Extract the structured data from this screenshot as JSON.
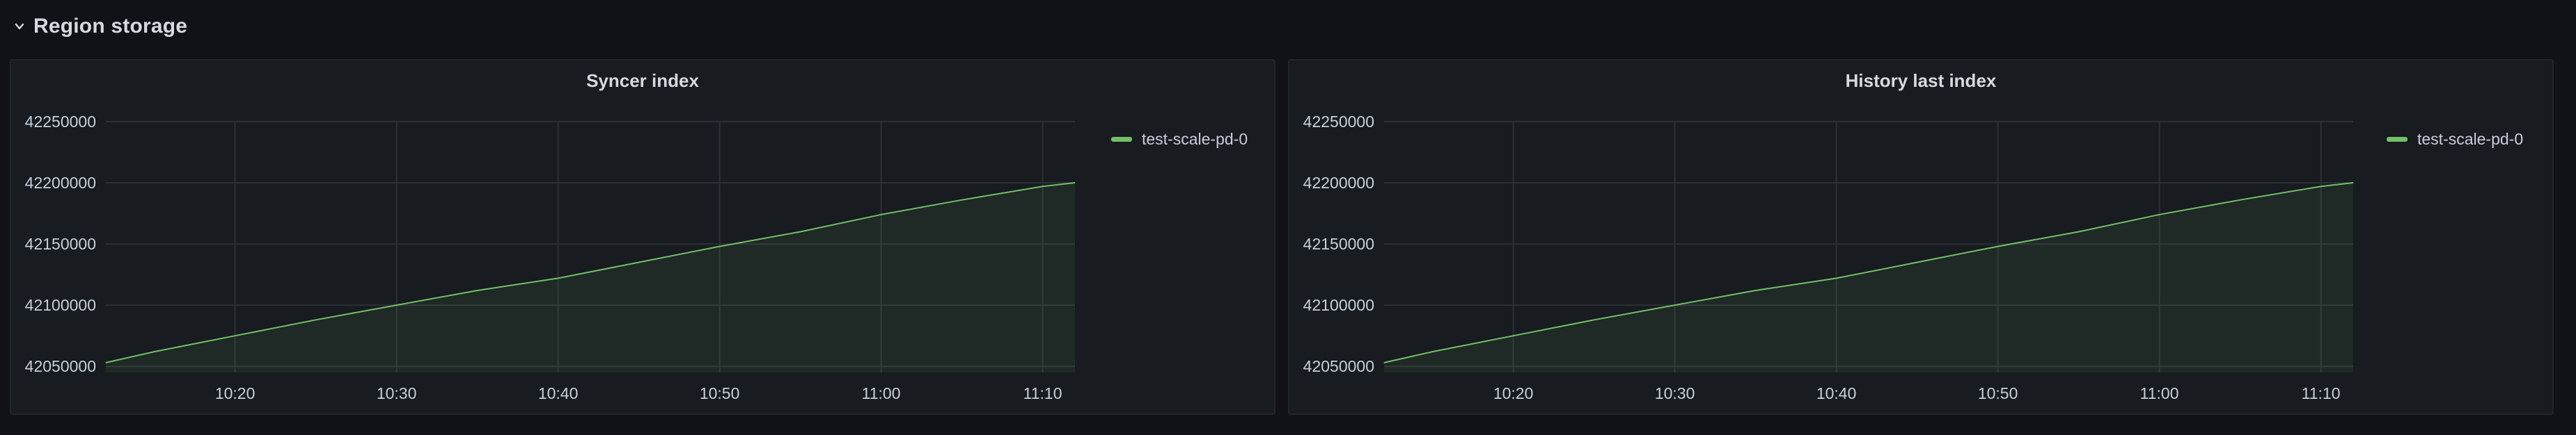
{
  "row": {
    "title": "Region storage",
    "icon": "chevron-down-icon"
  },
  "colors": {
    "series": "#73bf69",
    "grid": "#2c3036",
    "panel_bg": "#181b1f",
    "page_bg": "#111217"
  },
  "panels": [
    {
      "title": "Syncer index",
      "legend": "test-scale-pd-0"
    },
    {
      "title": "History last index",
      "legend": "test-scale-pd-0"
    }
  ],
  "chart_data": [
    {
      "type": "area",
      "title": "Syncer index",
      "x_tick_labels": [
        "10:20",
        "10:30",
        "10:40",
        "10:50",
        "11:00",
        "11:10"
      ],
      "y_tick_labels": [
        "42250000",
        "42200000",
        "42150000",
        "42100000",
        "42050000"
      ],
      "xlim": [
        "10:12",
        "11:12"
      ],
      "ylim": [
        42045000,
        42250000
      ],
      "grid": true,
      "legend_position": "right",
      "series": [
        {
          "name": "test-scale-pd-0",
          "x": [
            "10:12",
            "10:15",
            "10:20",
            "10:25",
            "10:30",
            "10:35",
            "10:40",
            "10:45",
            "10:50",
            "10:55",
            "11:00",
            "11:05",
            "11:10",
            "11:12"
          ],
          "values": [
            42053000,
            42062000,
            42075000,
            42088000,
            42100000,
            42112000,
            42122000,
            42135000,
            42148000,
            42160000,
            42174000,
            42186000,
            42197000,
            42200000
          ]
        }
      ]
    },
    {
      "type": "area",
      "title": "History last index",
      "x_tick_labels": [
        "10:20",
        "10:30",
        "10:40",
        "10:50",
        "11:00",
        "11:10"
      ],
      "y_tick_labels": [
        "42250000",
        "42200000",
        "42150000",
        "42100000",
        "42050000"
      ],
      "xlim": [
        "10:12",
        "11:12"
      ],
      "ylim": [
        42045000,
        42250000
      ],
      "grid": true,
      "legend_position": "right",
      "series": [
        {
          "name": "test-scale-pd-0",
          "x": [
            "10:12",
            "10:15",
            "10:20",
            "10:25",
            "10:30",
            "10:35",
            "10:40",
            "10:45",
            "10:50",
            "10:55",
            "11:00",
            "11:05",
            "11:10",
            "11:12"
          ],
          "values": [
            42053000,
            42062000,
            42075000,
            42088000,
            42100000,
            42112000,
            42122000,
            42135000,
            42148000,
            42160000,
            42174000,
            42186000,
            42197000,
            42200000
          ]
        }
      ]
    }
  ]
}
